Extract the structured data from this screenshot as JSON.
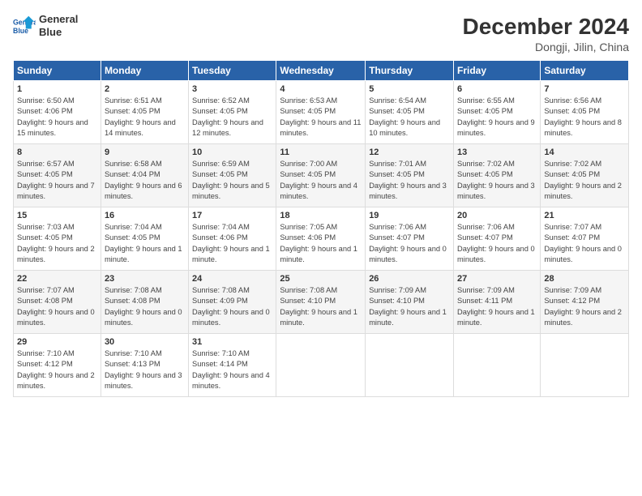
{
  "logo": {
    "line1": "General",
    "line2": "Blue"
  },
  "title": "December 2024",
  "subtitle": "Dongji, Jilin, China",
  "days_header": [
    "Sunday",
    "Monday",
    "Tuesday",
    "Wednesday",
    "Thursday",
    "Friday",
    "Saturday"
  ],
  "weeks": [
    [
      {
        "day": "1",
        "sunrise": "6:50 AM",
        "sunset": "4:06 PM",
        "daylight": "9 hours and 15 minutes."
      },
      {
        "day": "2",
        "sunrise": "6:51 AM",
        "sunset": "4:05 PM",
        "daylight": "9 hours and 14 minutes."
      },
      {
        "day": "3",
        "sunrise": "6:52 AM",
        "sunset": "4:05 PM",
        "daylight": "9 hours and 12 minutes."
      },
      {
        "day": "4",
        "sunrise": "6:53 AM",
        "sunset": "4:05 PM",
        "daylight": "9 hours and 11 minutes."
      },
      {
        "day": "5",
        "sunrise": "6:54 AM",
        "sunset": "4:05 PM",
        "daylight": "9 hours and 10 minutes."
      },
      {
        "day": "6",
        "sunrise": "6:55 AM",
        "sunset": "4:05 PM",
        "daylight": "9 hours and 9 minutes."
      },
      {
        "day": "7",
        "sunrise": "6:56 AM",
        "sunset": "4:05 PM",
        "daylight": "9 hours and 8 minutes."
      }
    ],
    [
      {
        "day": "8",
        "sunrise": "6:57 AM",
        "sunset": "4:05 PM",
        "daylight": "9 hours and 7 minutes."
      },
      {
        "day": "9",
        "sunrise": "6:58 AM",
        "sunset": "4:04 PM",
        "daylight": "9 hours and 6 minutes."
      },
      {
        "day": "10",
        "sunrise": "6:59 AM",
        "sunset": "4:05 PM",
        "daylight": "9 hours and 5 minutes."
      },
      {
        "day": "11",
        "sunrise": "7:00 AM",
        "sunset": "4:05 PM",
        "daylight": "9 hours and 4 minutes."
      },
      {
        "day": "12",
        "sunrise": "7:01 AM",
        "sunset": "4:05 PM",
        "daylight": "9 hours and 3 minutes."
      },
      {
        "day": "13",
        "sunrise": "7:02 AM",
        "sunset": "4:05 PM",
        "daylight": "9 hours and 3 minutes."
      },
      {
        "day": "14",
        "sunrise": "7:02 AM",
        "sunset": "4:05 PM",
        "daylight": "9 hours and 2 minutes."
      }
    ],
    [
      {
        "day": "15",
        "sunrise": "7:03 AM",
        "sunset": "4:05 PM",
        "daylight": "9 hours and 2 minutes."
      },
      {
        "day": "16",
        "sunrise": "7:04 AM",
        "sunset": "4:05 PM",
        "daylight": "9 hours and 1 minute."
      },
      {
        "day": "17",
        "sunrise": "7:04 AM",
        "sunset": "4:06 PM",
        "daylight": "9 hours and 1 minute."
      },
      {
        "day": "18",
        "sunrise": "7:05 AM",
        "sunset": "4:06 PM",
        "daylight": "9 hours and 1 minute."
      },
      {
        "day": "19",
        "sunrise": "7:06 AM",
        "sunset": "4:07 PM",
        "daylight": "9 hours and 0 minutes."
      },
      {
        "day": "20",
        "sunrise": "7:06 AM",
        "sunset": "4:07 PM",
        "daylight": "9 hours and 0 minutes."
      },
      {
        "day": "21",
        "sunrise": "7:07 AM",
        "sunset": "4:07 PM",
        "daylight": "9 hours and 0 minutes."
      }
    ],
    [
      {
        "day": "22",
        "sunrise": "7:07 AM",
        "sunset": "4:08 PM",
        "daylight": "9 hours and 0 minutes."
      },
      {
        "day": "23",
        "sunrise": "7:08 AM",
        "sunset": "4:08 PM",
        "daylight": "9 hours and 0 minutes."
      },
      {
        "day": "24",
        "sunrise": "7:08 AM",
        "sunset": "4:09 PM",
        "daylight": "9 hours and 0 minutes."
      },
      {
        "day": "25",
        "sunrise": "7:08 AM",
        "sunset": "4:10 PM",
        "daylight": "9 hours and 1 minute."
      },
      {
        "day": "26",
        "sunrise": "7:09 AM",
        "sunset": "4:10 PM",
        "daylight": "9 hours and 1 minute."
      },
      {
        "day": "27",
        "sunrise": "7:09 AM",
        "sunset": "4:11 PM",
        "daylight": "9 hours and 1 minute."
      },
      {
        "day": "28",
        "sunrise": "7:09 AM",
        "sunset": "4:12 PM",
        "daylight": "9 hours and 2 minutes."
      }
    ],
    [
      {
        "day": "29",
        "sunrise": "7:10 AM",
        "sunset": "4:12 PM",
        "daylight": "9 hours and 2 minutes."
      },
      {
        "day": "30",
        "sunrise": "7:10 AM",
        "sunset": "4:13 PM",
        "daylight": "9 hours and 3 minutes."
      },
      {
        "day": "31",
        "sunrise": "7:10 AM",
        "sunset": "4:14 PM",
        "daylight": "9 hours and 4 minutes."
      },
      null,
      null,
      null,
      null
    ]
  ]
}
